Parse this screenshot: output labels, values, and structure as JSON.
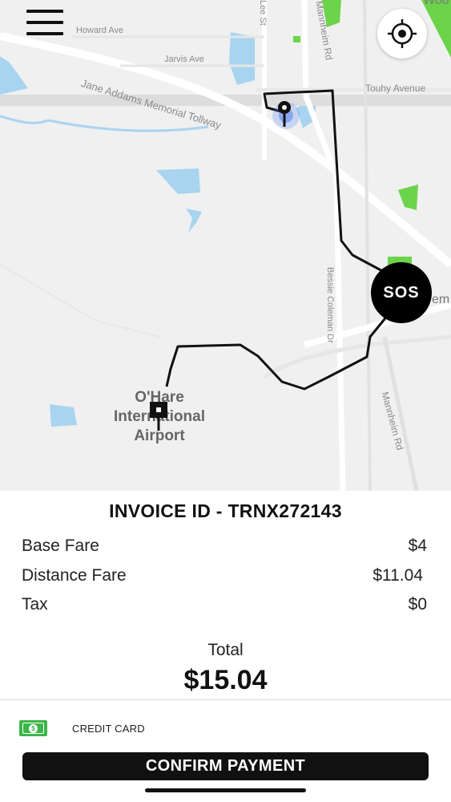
{
  "map": {
    "street_labels": {
      "howard": "Howard Ave",
      "jarvis": "Jarvis Ave",
      "tollway": "Jane Addams Memorial Tollway",
      "touhy": "Touhy Avenue",
      "lee": "Lee St",
      "mannheim_top": "Mannheim Rd",
      "mannheim_bottom": "Mannheim Rd",
      "bessie": "Bessie Coleman Dr",
      "woo": "Woo",
      "em": "em"
    },
    "airport": {
      "line1": "O'Hare",
      "line2": "International",
      "line3": "Airport"
    },
    "icons": {
      "menu": "hamburger-menu-icon",
      "locate": "crosshair-icon",
      "pickup": "pickup-pin-icon",
      "dropoff": "dropoff-flag-icon"
    },
    "colors": {
      "route": "#111111",
      "water": "#a8d4f0",
      "park": "#6bd44a",
      "land": "#f0f0f0",
      "road": "#ffffff",
      "pickup_halo": "#4a7cf0"
    },
    "sos_label": "SOS"
  },
  "invoice": {
    "title": "INVOICE ID - TRNX272143",
    "rows": [
      {
        "label": "Base Fare",
        "value": "$4"
      },
      {
        "label": "Distance Fare",
        "value": "$11.04"
      },
      {
        "label": "Tax",
        "value": "$0"
      }
    ],
    "total_label": "Total",
    "total_value": "$15.04"
  },
  "payment": {
    "method_label": "CREDIT CARD",
    "method_icon": "cash-icon",
    "accent": "#3cb54a"
  },
  "actions": {
    "confirm_label": "CONFIRM PAYMENT"
  }
}
